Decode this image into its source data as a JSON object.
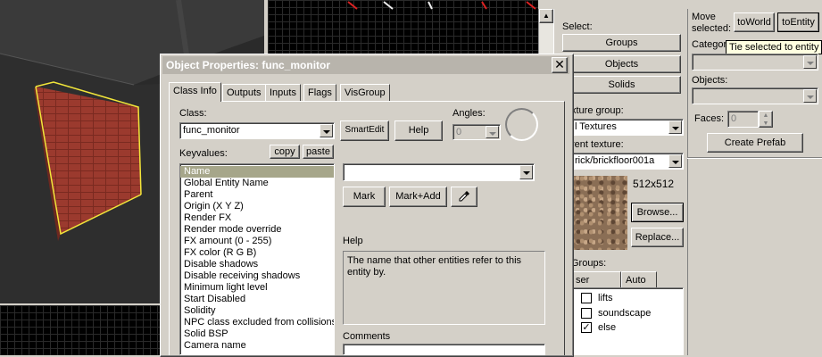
{
  "viewport": {
    "texture_size": "512x512"
  },
  "right_panel": {
    "select_label": "Select:",
    "groups_button": "Groups",
    "objects_button": "Objects",
    "solids_button": "Solids",
    "texture_group_label": "xture group:",
    "texture_group_value": "l Textures",
    "current_texture_label": "rent texture:",
    "current_texture_value": "rick/brickfloor001a",
    "browse_button": "Browse...",
    "replace_button": "Replace...",
    "visgroups_label": "Groups:",
    "visgroup_tabs": [
      "ser",
      "Auto"
    ],
    "visgroup_items": [
      {
        "label": "lifts",
        "checked": ""
      },
      {
        "label": "soundscape",
        "checked": ""
      },
      {
        "label": "else",
        "checked": "✓"
      }
    ]
  },
  "far_right": {
    "move_selected_label1": "Move",
    "move_selected_label2": "selected:",
    "to_world_button": "toWorld",
    "to_entity_button": "toEntity",
    "tooltip": "Tie selected to entity",
    "categories_label": "Categor",
    "objects_label": "Objects:",
    "faces_label": "Faces:",
    "faces_value": "0",
    "create_prefab_button": "Create Prefab"
  },
  "dialog": {
    "title": "Object Properties: func_monitor",
    "tabs": [
      "Class Info",
      "Outputs",
      "Inputs",
      "Flags",
      "VisGroup"
    ],
    "class_label": "Class:",
    "class_value": "func_monitor",
    "smartedit_button": "SmartEdit",
    "help_button": "Help",
    "angles_label": "Angles:",
    "angles_value": "0",
    "keyvalues_label": "Keyvalues:",
    "copy_button": "copy",
    "paste_button": "paste",
    "keyvalues": [
      "Name",
      "Global Entity Name",
      "Parent",
      "Origin (X Y Z)",
      "Render FX",
      "Render mode override",
      "FX amount (0 - 255)",
      "FX color (R G B)",
      "Disable shadows",
      "Disable receiving shadows",
      "Minimum light level",
      "Start Disabled",
      "Solidity",
      "NPC class excluded from collisions",
      "Solid BSP",
      "Camera name"
    ],
    "value_field": "",
    "mark_button": "Mark",
    "mark_add_button": "Mark+Add",
    "help_label": "Help",
    "help_text": "The name that other entities refer to this entity by.",
    "comments_label": "Comments"
  },
  "colors": {
    "title_inactive": "#b8b4ac",
    "selection": "#a6a68a",
    "brick": "#9b3a2e",
    "wire_yellow": "#f2e63a"
  }
}
